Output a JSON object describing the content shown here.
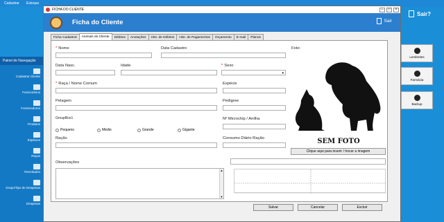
{
  "background": {
    "menu": [
      "Cadastrar",
      "Estoque"
    ],
    "panel_title": "Painel de Navegação",
    "sidebar_items": [
      "Cadastrar Cliente",
      "Funcionários",
      "Fornecedores",
      "Produtos",
      "Espécies",
      "Raças",
      "Receituário",
      "Grupo/Tipo de Despesas",
      "Despesas"
    ],
    "sair_label": "Sair?",
    "right_buttons": [
      "Lembretes",
      "Farmácia",
      "Backup"
    ]
  },
  "dialog": {
    "window_title": "FICHA DO CLIENTE",
    "heading": "Ficha do Cliente",
    "exit_label": "Sair",
    "tabs": [
      "Ficha Cadastral",
      "Animais do Cliente",
      "Débitos",
      "Anotações",
      "Hist. de Débitos",
      "Hist. de Pagamentos",
      "Orçamento",
      "E-mail",
      "Planos"
    ],
    "active_tab": "Animais do Cliente",
    "form": {
      "nome_label": "Nome",
      "data_cadastro_label": "Data Cadastro",
      "foto_label": "Foto:",
      "data_nasc_label": "Data Nasc.",
      "idade_label": "Idade",
      "sexo_label": "Sexo",
      "raca_label": "Raça / Nome Comum",
      "especie_label": "Espécie",
      "pelagem_label": "Pelagem",
      "pedigree_label": "Pedigree",
      "groupbox_label": "GroupBox1",
      "size_options": [
        "Pequeno",
        "Médio",
        "Grande",
        "Gigante"
      ],
      "microchip_label": "Nº Microchip / Anilha",
      "racao_label": "Ração",
      "consumo_label": "Consumo Diário Ração",
      "observacoes_label": "Observações",
      "photo_caption": "SEM FOTO",
      "photo_button": "Clique aqui para inserir / trocar a imagem"
    },
    "buttons": {
      "save": "Salvar",
      "cancel": "Cancelar",
      "delete": "Excluir"
    }
  }
}
